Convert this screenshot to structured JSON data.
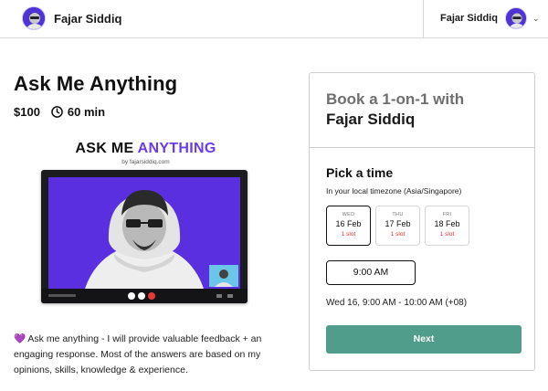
{
  "header": {
    "brand_name": "Fajar Siddiq",
    "user_name": "Fajar Siddiq",
    "avatar_icon": "user-avatar",
    "menu_icon": "chevron-down-icon"
  },
  "product": {
    "title": "Ask Me Anything",
    "price": "$100",
    "duration": "60 min",
    "hero": {
      "title_part1": "ASK ME ",
      "title_part2": "ANYTHING",
      "subtitle": "by fajarsiddiq.com"
    },
    "description_emoji": "💜",
    "description": "Ask me anything - I will provide valuable feedback + an engaging response. Most of the answers are based on my opinions, skills, knowledge & experience."
  },
  "booking": {
    "heading_line1": "Book a 1-on-1 with",
    "heading_line2": "Fajar Siddiq",
    "pick_time": "Pick a time",
    "timezone_text": "In your local timezone (Asia/Singapore)",
    "days": [
      {
        "dow": "WED",
        "date": "16 Feb",
        "slots": "1 slot",
        "selected": true
      },
      {
        "dow": "THU",
        "date": "17 Feb",
        "slots": "1 slot",
        "selected": false
      },
      {
        "dow": "FRI",
        "date": "18 Feb",
        "slots": "1 slot",
        "selected": false
      }
    ],
    "time_slot": "9:00 AM",
    "summary": "Wed 16, 9:00 AM - 10:00 AM (+08)",
    "next_label": "Next"
  },
  "colors": {
    "accent_purple": "#6a3dea",
    "next_button": "#4f9d8a",
    "slot_red": "#e03131"
  }
}
